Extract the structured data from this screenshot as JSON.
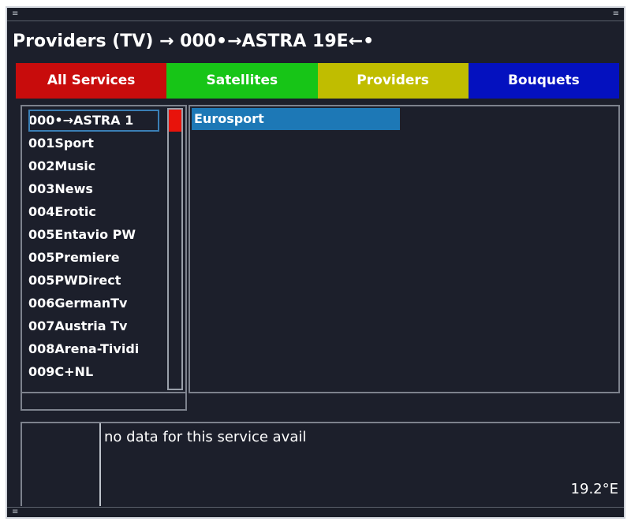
{
  "title": "Providers (TV) → 000•→ASTRA 19E←•",
  "color_buttons": [
    {
      "label": "All Services",
      "color": "#c80c0c"
    },
    {
      "label": "Satellites",
      "color": "#17c517"
    },
    {
      "label": "Providers",
      "color": "#c0bd00"
    },
    {
      "label": "Bouquets",
      "color": "#0411bf"
    }
  ],
  "providers": [
    "000•→ASTRA 1",
    "001Sport",
    "002Music",
    "003News",
    "004Erotic",
    "005Entavio PW",
    "005Premiere",
    "005PWDirect",
    "006GermanTv",
    "007Austria Tv",
    "008Arena-Tividi",
    "009C+NL"
  ],
  "selected_provider_index": 0,
  "services": [
    "Eurosport"
  ],
  "epg": {
    "text": "no data for this service avail",
    "orbital_position": "19.2°E"
  },
  "colors": {
    "background": "#1c1f2b",
    "selection": "#1d78b6",
    "scroll_thumb": "#e8130b"
  }
}
